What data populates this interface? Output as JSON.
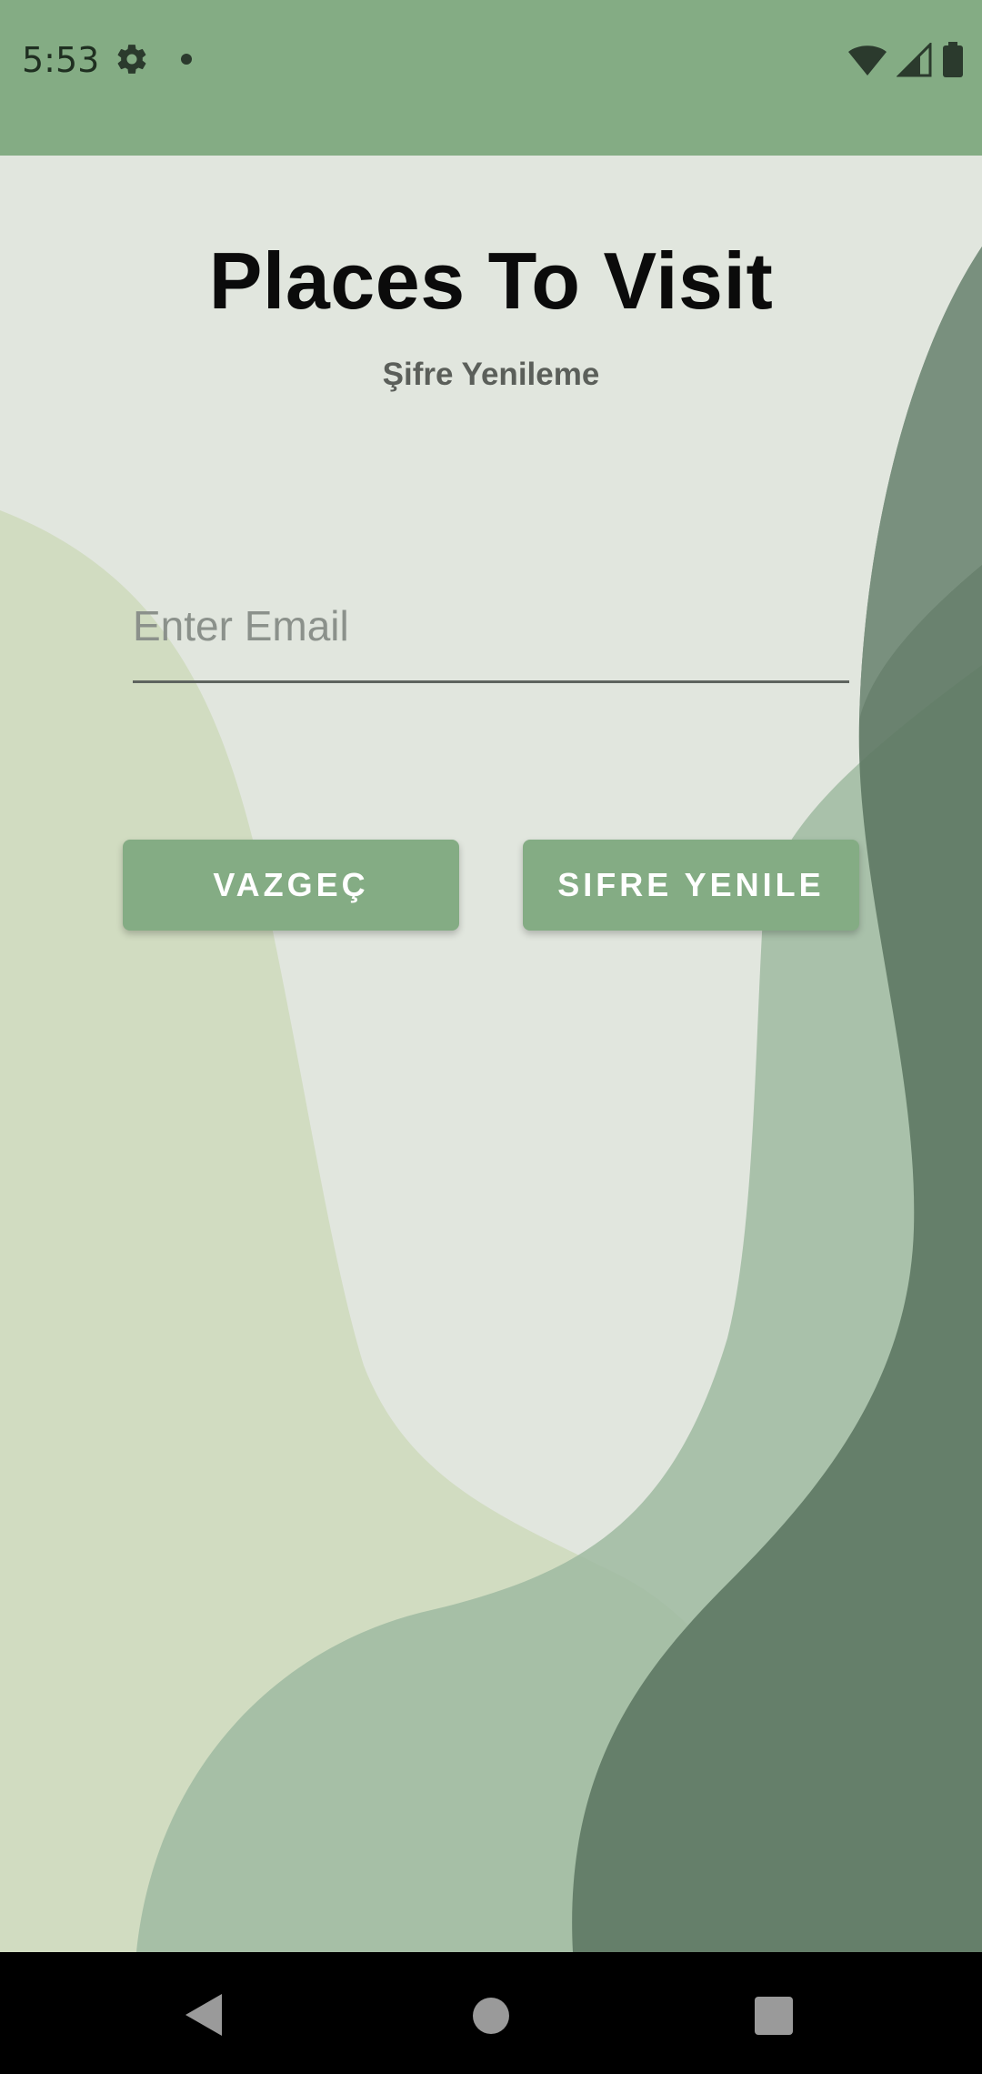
{
  "status_bar": {
    "time": "5:53",
    "icons_left": [
      "gear-icon",
      "dot-icon"
    ],
    "icons_right": [
      "wifi-icon",
      "signal-icon",
      "battery-icon"
    ]
  },
  "app": {
    "title": "Places To Visit",
    "subtitle": "Şifre Yenileme"
  },
  "email": {
    "placeholder": "Enter Email",
    "value": ""
  },
  "buttons": {
    "cancel_label": "VAZGEÇ",
    "reset_label": "SIFRE YENILE"
  },
  "colors": {
    "primary": "#84ac84",
    "background": "#e1e6de"
  },
  "nav": {
    "items": [
      "back-icon",
      "home-icon",
      "recents-icon"
    ]
  }
}
